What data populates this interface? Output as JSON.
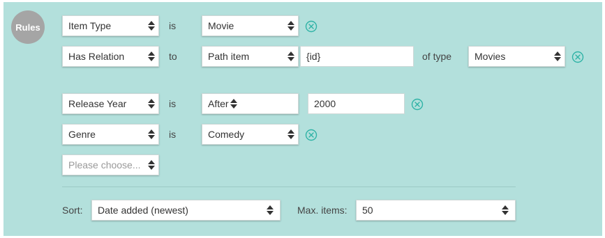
{
  "badge": "Rules",
  "rules": {
    "row1": {
      "field": "Item Type",
      "op": "is",
      "value": "Movie"
    },
    "row2": {
      "field": "Has Relation",
      "op": "to",
      "value": "Path item",
      "input": "{id}",
      "of_type_label": "of type",
      "type": "Movies"
    },
    "row3": {
      "field": "Release Year",
      "op": "is",
      "value": "After",
      "input": "2000"
    },
    "row4": {
      "field": "Genre",
      "op": "is",
      "value": "Comedy"
    },
    "new": {
      "placeholder": "Please choose..."
    }
  },
  "footer": {
    "sort_label": "Sort:",
    "sort_value": "Date added (newest)",
    "max_label": "Max. items:",
    "max_value": "50"
  },
  "colors": {
    "panel": "#b3e0dc",
    "badge": "#a5a5a5",
    "remove_icon": "#2fb3a6"
  },
  "icons": {
    "select": "up-down-arrows-icon",
    "remove": "circle-x-icon"
  }
}
